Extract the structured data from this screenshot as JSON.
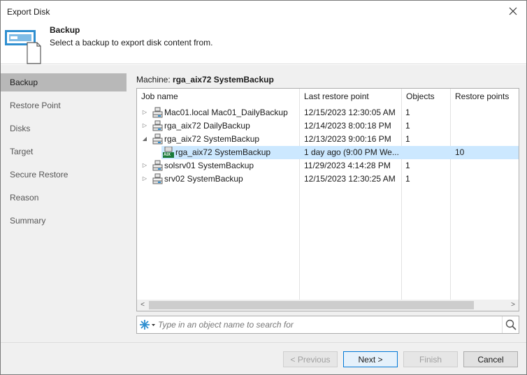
{
  "window": {
    "title": "Export Disk"
  },
  "header": {
    "title": "Backup",
    "subtitle": "Select a backup to export disk content from."
  },
  "sidebar": {
    "items": [
      {
        "label": "Backup",
        "active": true
      },
      {
        "label": "Restore Point"
      },
      {
        "label": "Disks"
      },
      {
        "label": "Target"
      },
      {
        "label": "Secure Restore"
      },
      {
        "label": "Reason"
      },
      {
        "label": "Summary"
      }
    ]
  },
  "main": {
    "machine_label": "Machine:",
    "machine_value": "rga_aix72 SystemBackup",
    "columns": [
      "Job name",
      "Last restore point",
      "Objects",
      "Restore points"
    ],
    "rows": [
      {
        "name": "Mac01.local Mac01_DailyBackup",
        "last": "12/15/2023 12:30:05 AM",
        "objects": "1",
        "restore_points": "",
        "expander": "▷"
      },
      {
        "name": "rga_aix72 DailyBackup",
        "last": "12/14/2023 8:00:18 PM",
        "objects": "1",
        "restore_points": "",
        "expander": "▷"
      },
      {
        "name": "rga_aix72 SystemBackup",
        "last": "12/13/2023 9:00:16 PM",
        "objects": "1",
        "restore_points": "",
        "expander": "◢"
      },
      {
        "name": "rga_aix72 SystemBackup",
        "last": "1 day ago (9:00 PM We...",
        "objects": "",
        "restore_points": "10",
        "expander": "",
        "child": true,
        "selected": true,
        "badge": "AIX"
      },
      {
        "name": "solsrv01 SystemBackup",
        "last": "11/29/2023 4:14:28 PM",
        "objects": "1",
        "restore_points": "",
        "expander": "▷"
      },
      {
        "name": "srv02 SystemBackup",
        "last": "12/15/2023 12:30:25 AM",
        "objects": "1",
        "restore_points": "",
        "expander": "▷"
      }
    ],
    "scroll_left": "<",
    "scroll_right": ">",
    "search_placeholder": "Type in an object name to search for"
  },
  "footer": {
    "previous": "< Previous",
    "next": "Next >",
    "finish": "Finish",
    "cancel": "Cancel"
  },
  "colors": {
    "accent": "#0078d7",
    "selection": "#cce8ff",
    "icon_blue": "#2f8fd0"
  }
}
